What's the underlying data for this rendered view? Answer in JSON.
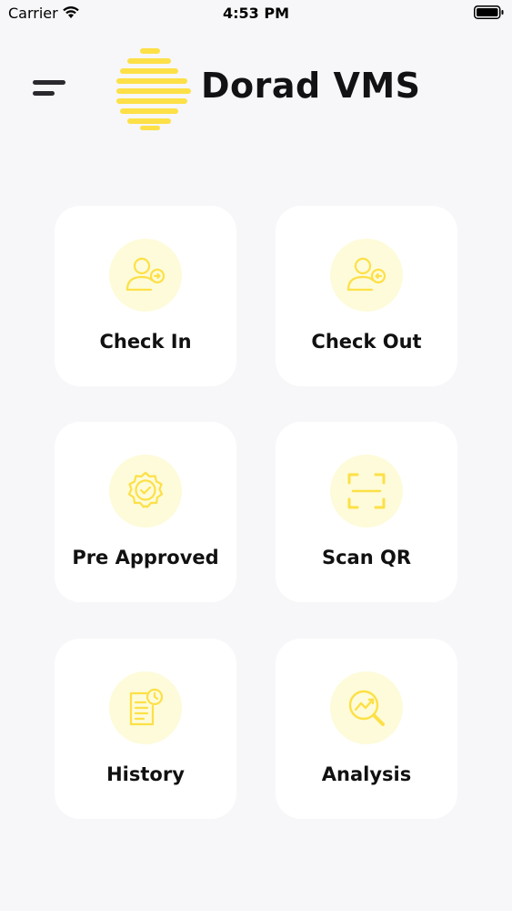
{
  "status_bar": {
    "carrier": "Carrier",
    "time": "4:53 PM",
    "wifi_icon": "wifi-icon",
    "battery_icon": "battery-icon"
  },
  "header": {
    "menu_icon": "hamburger-menu-icon",
    "logo_icon": "dorad-logo",
    "title": "Dorad VMS"
  },
  "colors": {
    "background": "#f7f7f9",
    "tile": "#ffffff",
    "accent": "#fde047",
    "icon_circle": "#fdfbd9",
    "text": "#111111"
  },
  "tiles": [
    {
      "label": "Check In",
      "icon": "user-check-in-icon"
    },
    {
      "label": "Check Out",
      "icon": "user-check-out-icon"
    },
    {
      "label": "Pre Approved",
      "icon": "approved-badge-icon"
    },
    {
      "label": "Scan QR",
      "icon": "scan-qr-icon"
    },
    {
      "label": "History",
      "icon": "history-document-icon"
    },
    {
      "label": "Analysis",
      "icon": "analysis-magnifier-icon"
    }
  ]
}
